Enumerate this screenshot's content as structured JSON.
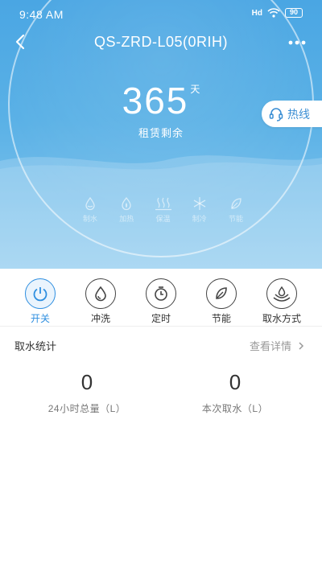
{
  "status_bar": {
    "time": "9:48 AM",
    "signal": "Hd",
    "battery": "90"
  },
  "header": {
    "title": "QS-ZRD-L05(0RIH)"
  },
  "lease": {
    "days": "365",
    "unit": "天",
    "label": "租赁剩余"
  },
  "hotline": {
    "label": "热线"
  },
  "modes": [
    {
      "label": "制水",
      "icon": "water-making-icon"
    },
    {
      "label": "加热",
      "icon": "heating-icon"
    },
    {
      "label": "保温",
      "icon": "keep-warm-icon"
    },
    {
      "label": "制冷",
      "icon": "cooling-icon"
    },
    {
      "label": "节能",
      "icon": "energy-saving-icon"
    }
  ],
  "controls": [
    {
      "label": "开关",
      "icon": "power-icon",
      "active": true
    },
    {
      "label": "冲洗",
      "icon": "flush-icon",
      "active": false
    },
    {
      "label": "定时",
      "icon": "timer-icon",
      "active": false
    },
    {
      "label": "节能",
      "icon": "leaf-icon",
      "active": false
    },
    {
      "label": "取水方式",
      "icon": "water-mode-icon",
      "active": false
    }
  ],
  "stats": {
    "title": "取水统计",
    "detail_link": "查看详情",
    "total_24h": {
      "value": "0",
      "label": "24小时总量（L）"
    },
    "this_time": {
      "value": "0",
      "label": "本次取水（L）"
    }
  },
  "colors": {
    "primary": "#4aa6e3",
    "accent": "#2f8fe0",
    "hotline_text": "#3a8ed4"
  }
}
